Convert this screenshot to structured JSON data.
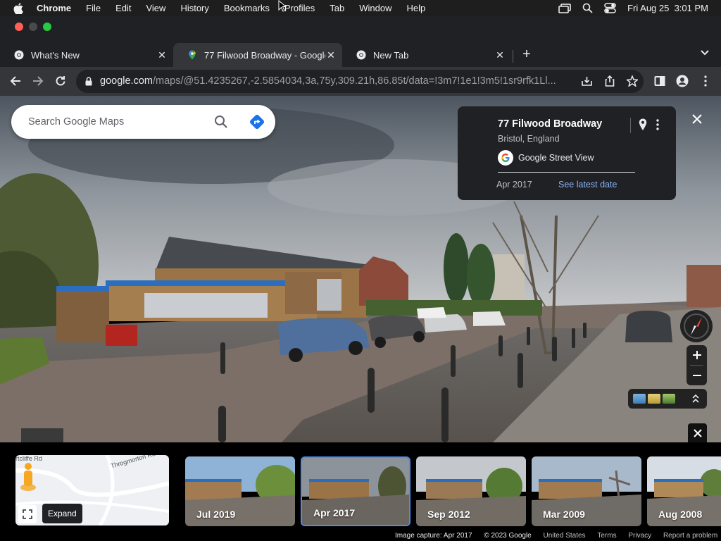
{
  "menubar": {
    "app": "Chrome",
    "items": [
      "File",
      "Edit",
      "View",
      "History",
      "Bookmarks",
      "Profiles",
      "Tab",
      "Window",
      "Help"
    ],
    "datetime": "Fri Aug 25  3:01 PM"
  },
  "tabs": [
    {
      "label": "What's New",
      "icon": "chrome-icon"
    },
    {
      "label": "77 Filwood Broadway - Google",
      "icon": "maps-pin-icon"
    },
    {
      "label": "New Tab",
      "icon": "chrome-icon"
    }
  ],
  "address": {
    "domain": "google.com",
    "path": "/maps/@51.4235267,-2.5854034,3a,75y,309.21h,86.85t/data=!3m7!1e1!3m5!1sr9rfk1Ll..."
  },
  "search": {
    "placeholder": "Search Google Maps"
  },
  "infocard": {
    "title": "77 Filwood Broadway",
    "subtitle": "Bristol, England",
    "provider": "Google Street View",
    "date": "Apr 2017",
    "latest_link": "See latest date"
  },
  "minimap": {
    "road1": "rtcliffe Rd",
    "road2": "Throgmorton Rd",
    "expand_label": "Expand"
  },
  "timeline": [
    {
      "label": "Jul 2019",
      "selected": false
    },
    {
      "label": "Apr 2017",
      "selected": true
    },
    {
      "label": "Sep 2012",
      "selected": false
    },
    {
      "label": "Mar 2009",
      "selected": false
    },
    {
      "label": "Aug 2008",
      "selected": false
    }
  ],
  "footer": {
    "capture": "Image capture: Apr 2017",
    "copyright": "© 2023 Google",
    "region": "United States",
    "terms": "Terms",
    "privacy": "Privacy",
    "report": "Report a problem"
  },
  "colors": {
    "accent": "#4d8cf5",
    "link": "#8ab4f8"
  }
}
